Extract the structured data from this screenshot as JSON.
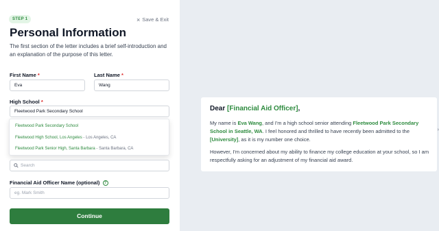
{
  "header": {
    "step": "STEP 1",
    "save_exit": "Save & Exit",
    "title": "Personal Information",
    "description": "The first section of the letter includes a brief self-introduction and an explanation of the purpose of this letter."
  },
  "form": {
    "first_name": {
      "label": "First Name",
      "required": "*",
      "value": "Eva"
    },
    "last_name": {
      "label": "Last Name",
      "required": "*",
      "value": "Wang"
    },
    "high_school": {
      "label": "High School",
      "required": "*",
      "value": "Fleetwood Park Secondary School"
    },
    "school_options": [
      {
        "name": "Fleetwood Park Secondary School",
        "location": ""
      },
      {
        "name": "Fleetwood High School, Los Angeles",
        "location": " - Los Angeles, CA"
      },
      {
        "name": "Fleetwood Park Senior High, Santa Barbara",
        "location": " - Santa Barbara, CA"
      }
    ],
    "search": {
      "placeholder": "Search"
    },
    "officer_name": {
      "label": "Financial Aid Officer Name (optional)",
      "help": "?",
      "placeholder": "eg. Mark Smith"
    },
    "continue_label": "Continue"
  },
  "preview": {
    "greeting_prefix": "Dear ",
    "greeting_officer": "[Financial Aid Officer]",
    "greeting_suffix": ",",
    "p1": {
      "t1": "My name is ",
      "name": "Eva Wang",
      "t2": ", and I'm a high school senior attending ",
      "school": "Fleetwood Park Secondary School in Seattle, WA",
      "t3": ". I feel honored and thrilled to have recently been admitted to the ",
      "university": "[University]",
      "t4": ", as it is my number one choice."
    },
    "p2": "However, I'm concerned about my ability to finance my college education at your school, so I am respectfully asking for an adjustment of my financial aid award."
  },
  "colors": {
    "accent": "#2e8b3f",
    "button": "#2e7d3e",
    "background": "#e9edf2"
  },
  "icons": [
    "close-icon",
    "search-icon",
    "help-icon",
    "chevron-right-icon"
  ]
}
